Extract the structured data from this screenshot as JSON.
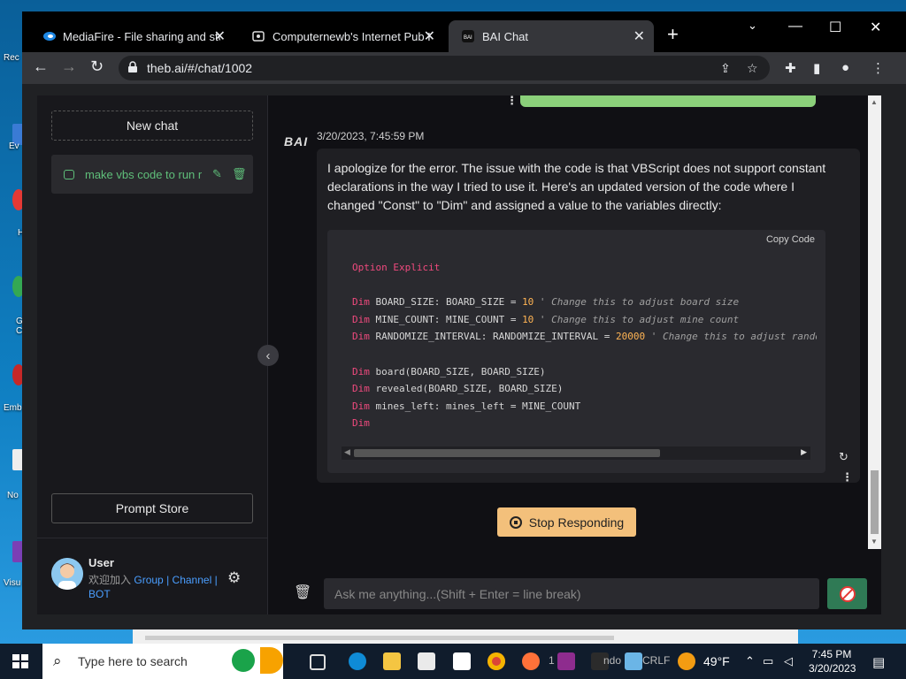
{
  "browser": {
    "tabs": [
      {
        "title": "MediaFire - File sharing and storage"
      },
      {
        "title": "Computernewb's Internet Pub Hub"
      },
      {
        "title": "BAI Chat"
      }
    ],
    "url": "theb.ai/#/chat/1002"
  },
  "desktop": {
    "labels": [
      "Rec",
      "Ev",
      "H",
      "G C",
      "Emb De",
      "No",
      "Visu"
    ]
  },
  "sidebar": {
    "new_chat_label": "New chat",
    "chat_items": [
      {
        "title": "make vbs code to run minesweeper"
      }
    ],
    "prompt_store_label": "Prompt Store",
    "user": {
      "name": "User",
      "join_text": "欢迎加入",
      "link_group": "Group",
      "link_channel": "Channel",
      "link_bot": "BOT",
      "sep": "|"
    }
  },
  "chat": {
    "bot_name": "BAI",
    "message": {
      "timestamp": "3/20/2023, 7:45:59 PM",
      "text": "I apologize for the error. The issue with the code is that VBScript does not support constant declarations in the way I tried to use it. Here's an updated version of the code where I changed \"Const\" to \"Dim\" and assigned a value to the variables directly:",
      "copy_label": "Copy  Code",
      "code": {
        "l1_kw": "Option Explicit",
        "l3_kw": "Dim",
        "l3_a": " BOARD_SIZE: BOARD_SIZE = ",
        "l3_num": "10",
        "l3_cmt": " ' Change this to adjust board size",
        "l4_kw": "Dim",
        "l4_a": " MINE_COUNT: MINE_COUNT = ",
        "l4_num": "10",
        "l4_cmt": " ' Change this to adjust mine count",
        "l5_kw": "Dim",
        "l5_a": " RANDOMIZE_INTERVAL: RANDOMIZE_INTERVAL = ",
        "l5_num": "20000",
        "l5_cmt": " ' Change this to adjust random",
        "l7_kw": "Dim",
        "l7_a": " board(BOARD_SIZE, BOARD_SIZE)",
        "l8_kw": "Dim",
        "l8_a": " revealed(BOARD_SIZE, BOARD_SIZE)",
        "l9_kw": "Dim",
        "l9_a": " mines_left: mines_left = MINE_COUNT",
        "l10_kw": "Dim"
      }
    },
    "stop_label": "Stop Responding",
    "input_placeholder": "Ask me anything...(Shift + Enter = line break)"
  },
  "taskbar": {
    "search_placeholder": "Type here to search",
    "app_text_1": "1",
    "app_text_2": "ndo",
    "app_text_3": "CRLF",
    "temperature": "49°F",
    "time": "7:45 PM",
    "date": "3/20/2023"
  }
}
